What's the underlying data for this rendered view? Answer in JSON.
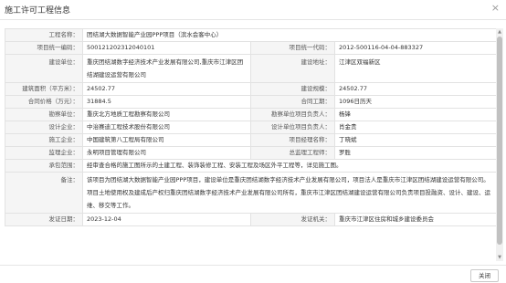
{
  "dialog": {
    "title": "施工许可工程信息",
    "close_glyph": "×"
  },
  "fields": {
    "project_name": {
      "label": "工程名称：",
      "value": "团结湖大数据智能产业园PPP项目（滨水会客中心）"
    },
    "project_code_1": {
      "label": "项目统一编码：",
      "value": "500121202312040101"
    },
    "project_code_2": {
      "label": "项目统一代码：",
      "value": "2012-500116-04-04-883327"
    },
    "build_unit": {
      "label": "建设单位：",
      "value": "重庆团结湖数字经济技术产业发展有限公司,重庆市江津区团结湖建设运营有限公司"
    },
    "build_address": {
      "label": "建设地址：",
      "value": "江津区双福新区"
    },
    "build_area": {
      "label": "建筑面积（平方米）：",
      "value": "24502.77"
    },
    "build_scale": {
      "label": "建设规模：",
      "value": "24502.77"
    },
    "contract_price": {
      "label": "合同价格（万元）：",
      "value": "31884.5"
    },
    "contract_period": {
      "label": "合同工期：",
      "value": "1096日历天"
    },
    "survey_unit": {
      "label": "勘察单位：",
      "value": "重庆北方地质工程勘察有限公司"
    },
    "survey_lead": {
      "label": "勘察单位项目负责人：",
      "value": "杨锋"
    },
    "design_unit": {
      "label": "设计企业：",
      "value": "中治赛迪工程技术股份有限公司"
    },
    "design_lead": {
      "label": "设计单位项目负责人：",
      "value": "肖金贵"
    },
    "construction_unit": {
      "label": "施工企业：",
      "value": "中国建筑第八工程局有限公司"
    },
    "project_manager": {
      "label": "项目经理名称：",
      "value": "丁晓斌"
    },
    "supervision_unit": {
      "label": "监理企业：",
      "value": "永明项目管理有限公司"
    },
    "chief_supervisor": {
      "label": "总监理工程师：",
      "value": "罗胜"
    },
    "contract_scope": {
      "label": "承包范围：",
      "value": "经审查合格的施工图所示的土建工程、装饰装修工程、安装工程及场区外平工程等，详见施工图。"
    },
    "remarks": {
      "label": "备注：",
      "value": "该项目为团结湖大数据智能产业园PPP项目，建设单位是重庆团结湖数字经济技术产业发展有限公司，项目法人是重庆市江津区团结湖建设运营有限公司。项目土地使用权及建成后产权归重庆团结湖数字经济技术产业发展有限公司所有，重庆市江津区团结湖建设运营有限公司负责项目投融资、设计、建设、运维、移交等工作。"
    },
    "issue_date": {
      "label": "发证日期：",
      "value": "2023-12-04"
    },
    "issue_authority": {
      "label": "发证机关：",
      "value": "重庆市江津区住房和城乡建设委员会"
    }
  },
  "footer": {
    "close_label": "关闭"
  }
}
